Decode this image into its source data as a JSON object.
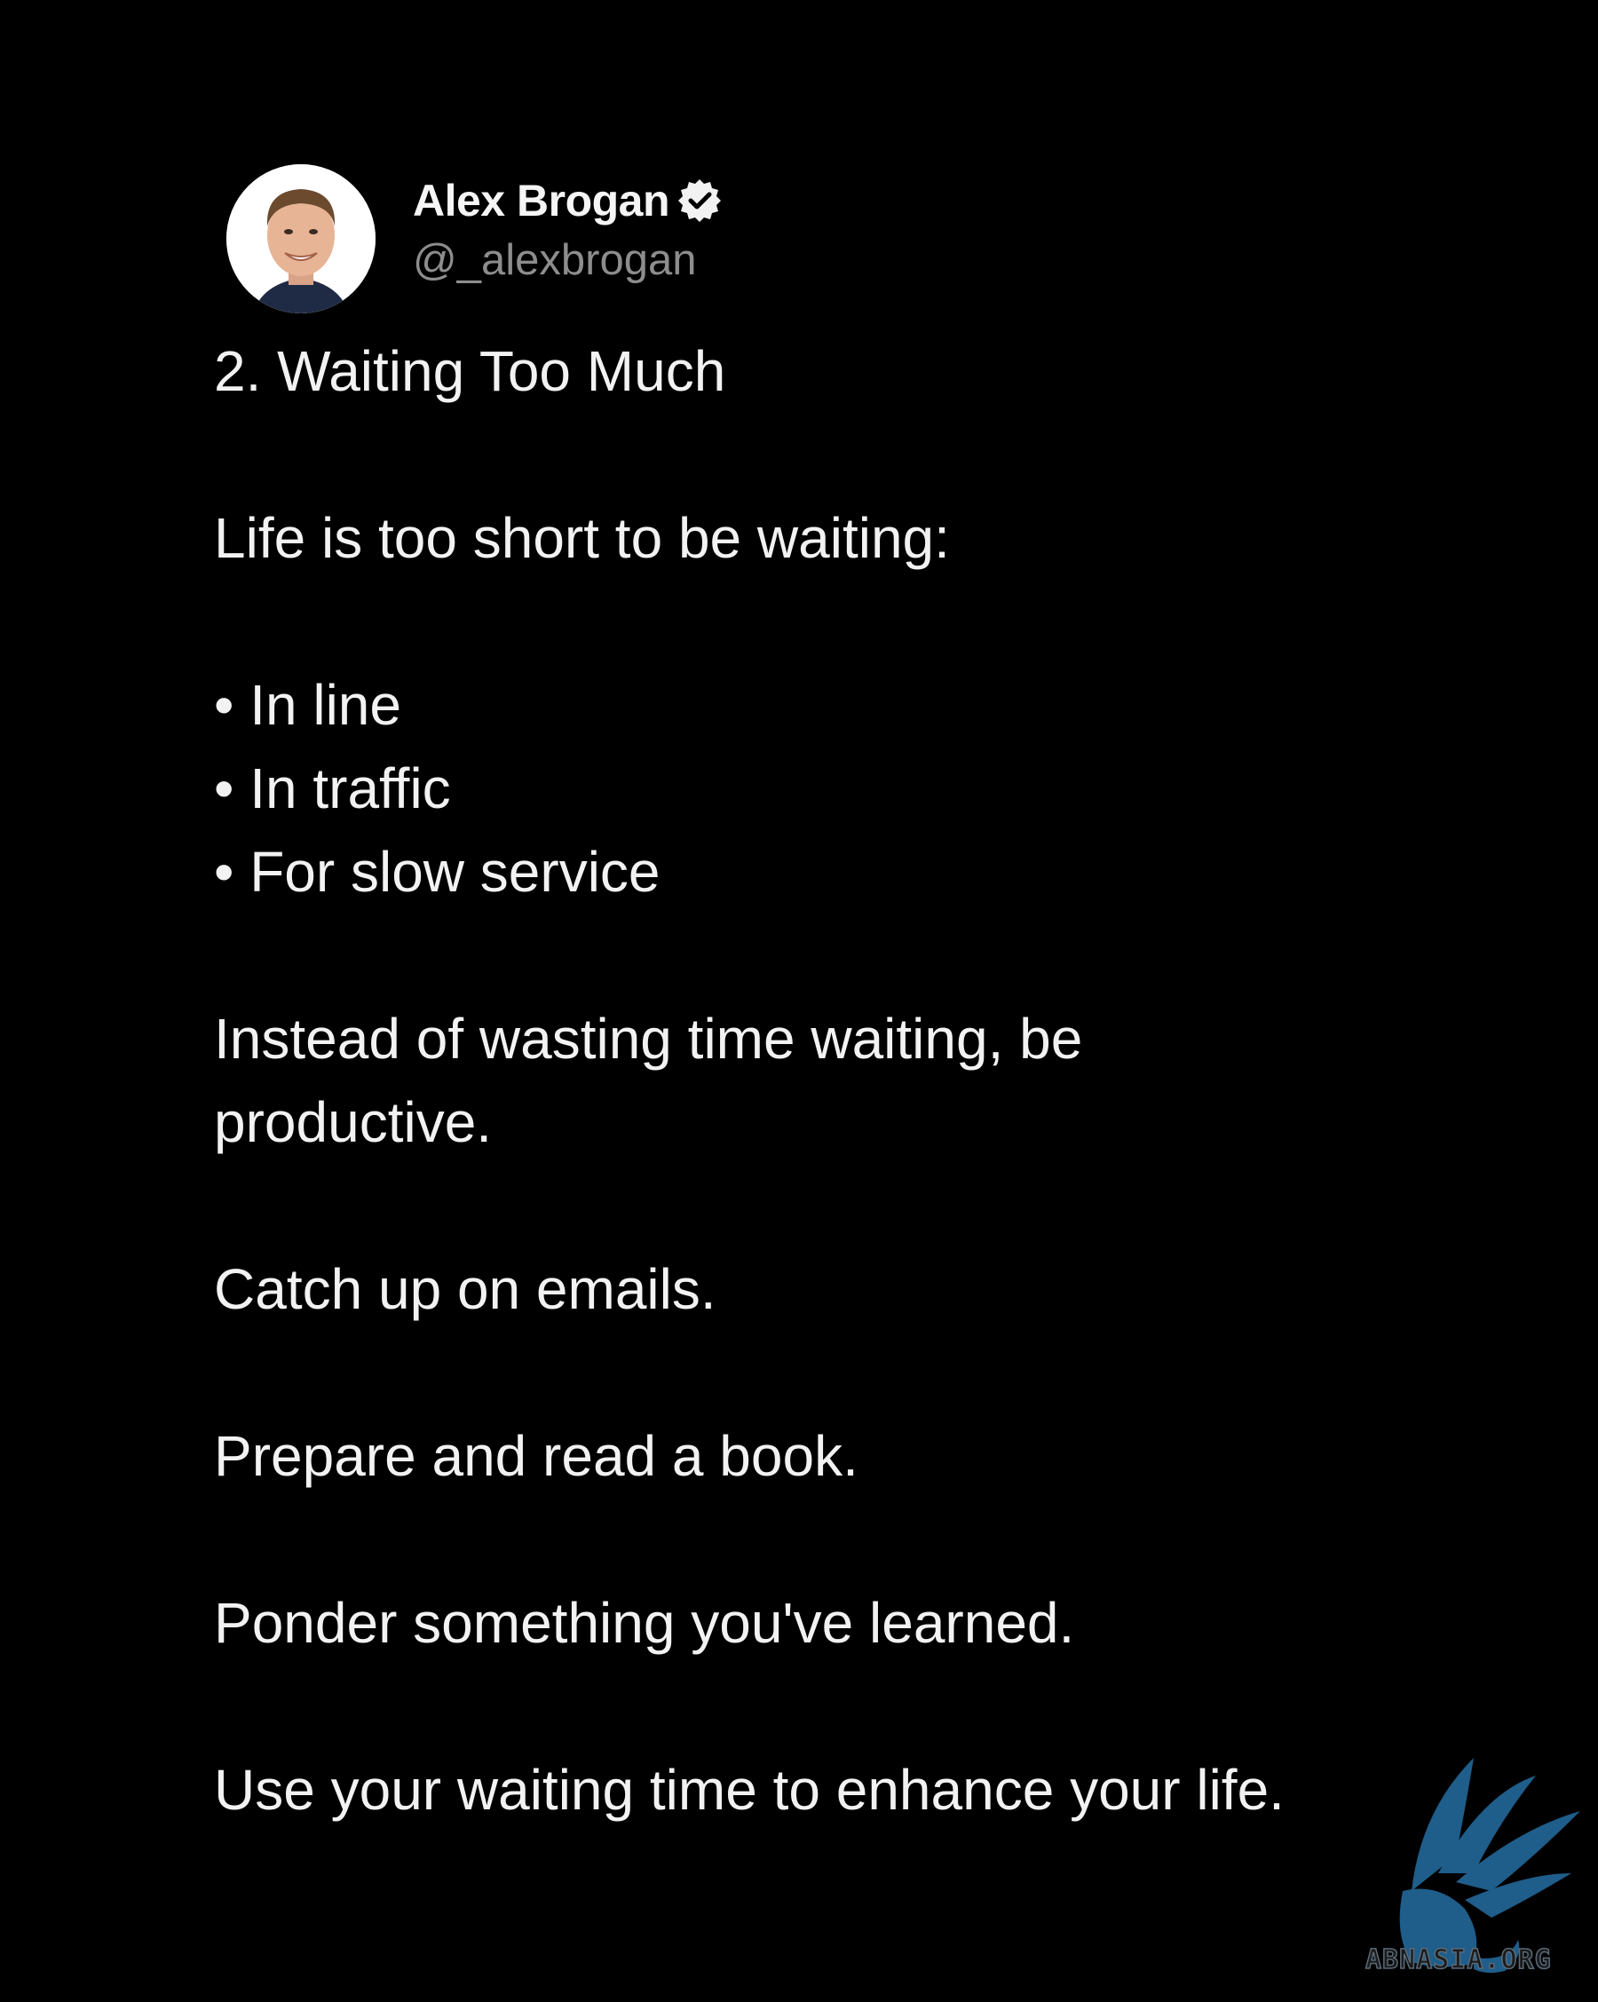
{
  "author": {
    "display_name": "Alex Brogan",
    "handle": "@_alexbrogan"
  },
  "post": {
    "paragraphs": [
      [
        "2. Waiting Too Much"
      ],
      [
        "Life is too short to be waiting:"
      ],
      [
        "• In line",
        "• In traffic",
        "• For slow service"
      ],
      [
        "Instead of wasting time waiting, be",
        "productive."
      ],
      [
        "Catch up on emails."
      ],
      [
        "Prepare and read a book."
      ],
      [
        "Ponder something you've learned."
      ],
      [
        "Use your waiting time to enhance your life."
      ]
    ]
  },
  "watermark": {
    "text": "ABNASIA.ORG",
    "color": "#1f5d8a"
  },
  "colors": {
    "background": "#000000",
    "text": "#f2f2f2",
    "handle": "#8d8d8d"
  }
}
